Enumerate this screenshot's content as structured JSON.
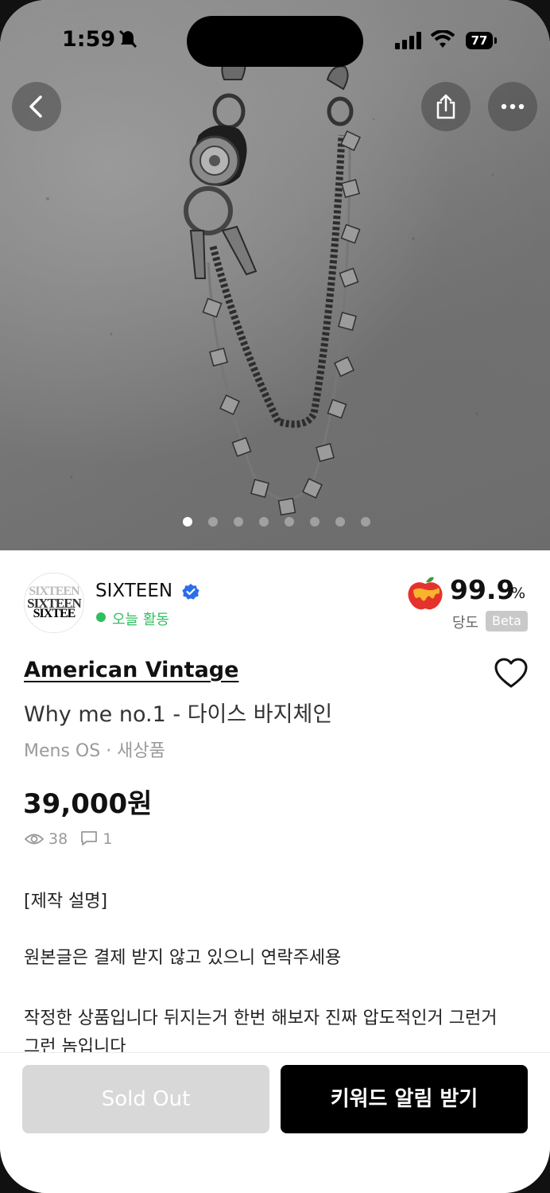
{
  "status_bar": {
    "time": "1:59",
    "battery": "77"
  },
  "carousel": {
    "total": 8,
    "active_index": 0
  },
  "seller": {
    "logo_lines": [
      "SIXTEEN",
      "SIXTEEN",
      "SIXTEE"
    ],
    "name": "SIXTEEN",
    "activity": "오늘 활동",
    "rating_value": "99.9",
    "rating_unit": "%",
    "rating_label": "당도",
    "rating_badge": "Beta"
  },
  "product": {
    "brand": "American Vintage",
    "title": "Why me no.1 - 다이스 바지체인",
    "meta": "Mens OS · 새상품",
    "price": "39,000원",
    "views": "38",
    "comments": "1",
    "description": [
      "[제작 설명]",
      "원본글은 결제 받지 않고 있으니 연락주세용",
      "작정한 상품입니다 뒤지는거 한번 해보자 진짜 압도적인거 그런거",
      "그런 놈입니다"
    ]
  },
  "actions": {
    "sold_out_label": "Sold Out",
    "keyword_alert_label": "키워드 알림 받기"
  },
  "colors": {
    "activity_green": "#2fbf5f",
    "verified_blue": "#2a6fe8",
    "primary_button": "#000000",
    "disabled_button": "#d8d8d8"
  }
}
